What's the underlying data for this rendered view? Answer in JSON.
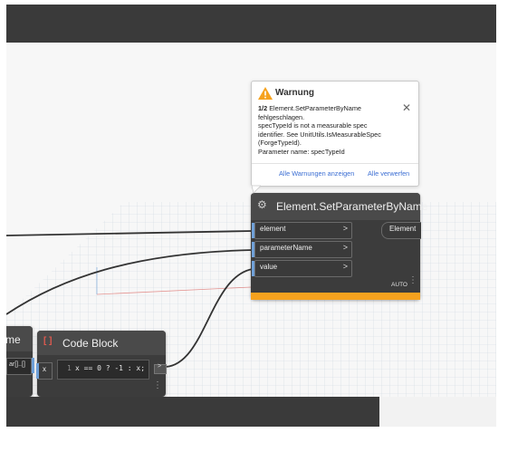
{
  "warning": {
    "title": "Warnung",
    "counter": "1/2",
    "message_line1": "Element.SetParameterByName",
    "message_line2": "fehlgeschlagen.",
    "message_line3": "specTypeId is not a measurable spec",
    "message_line4": "identifier. See UnitUtils.IsMeasurableSpec",
    "message_line5": "(ForgeTypeId).",
    "message_line6": "Parameter name: specTypeId",
    "show_all_label": "Alle Warnungen anzeigen",
    "dismiss_all_label": "Alle verwerfen"
  },
  "set_param_node": {
    "title": "Element.SetParameterByName",
    "inputs": [
      "element",
      "parameterName",
      "value"
    ],
    "output": "Element",
    "lacing": "AUTO",
    "warning_color": "#f6a21e"
  },
  "code_block_node": {
    "title": "Code Block",
    "line_number": "1",
    "code": "x == 0 ? -1 : x;",
    "input": "x",
    "output_chevron": ">"
  },
  "left_node": {
    "title_fragment": "me",
    "port_fragment": "ar[]..[]"
  },
  "colors": {
    "node_bg": "#3c3c3c",
    "header_bg": "#4a4a4a",
    "warning_orange": "#f6a21e",
    "port_blue": "#6fa0d8",
    "link_blue": "#3b6ed3",
    "wire": "#333333"
  }
}
